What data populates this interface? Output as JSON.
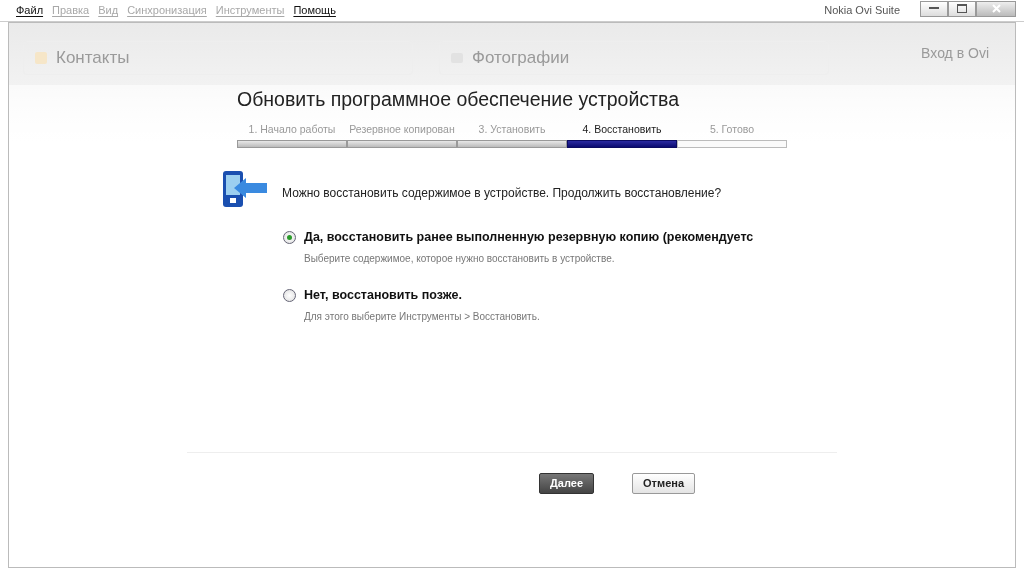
{
  "menu": [
    {
      "label": "Файл",
      "disabled": false
    },
    {
      "label": "Правка",
      "disabled": true
    },
    {
      "label": "Вид",
      "disabled": true
    },
    {
      "label": "Синхронизация",
      "disabled": true
    },
    {
      "label": "Инструменты",
      "disabled": true
    },
    {
      "label": "Помощь",
      "disabled": false
    }
  ],
  "window": {
    "title": "Nokia Ovi Suite"
  },
  "background": {
    "panels": [
      "Контакты",
      "Фотографии"
    ],
    "sign_in": "Вход в Ovi"
  },
  "dialog": {
    "title": "Обновить программное обеспечение устройства",
    "steps": [
      {
        "label": "1. Начало работы",
        "completed": true,
        "selected": false
      },
      {
        "label": "Резервное копирован",
        "completed": true,
        "selected": false
      },
      {
        "label": "3. Установить",
        "completed": true,
        "selected": false
      },
      {
        "label": "4. Восстановить",
        "completed": false,
        "selected": true
      },
      {
        "label": "5. Готово",
        "completed": false,
        "selected": false
      }
    ],
    "question": "Можно восстановить содержимое в устройстве. Продолжить восстановление?",
    "options": [
      {
        "label": "Да, восстановить ранее выполненную резервную копию (рекомендуетс",
        "hint": "Выберите содержимое, которое нужно восстановить в устройстве.",
        "selected": true
      },
      {
        "label": "Нет, восстановить позже.",
        "hint": "Для этого выберите Инструменты > Восстановить.",
        "selected": false
      }
    ],
    "buttons": [
      {
        "label": "Далее",
        "kind": "primary"
      },
      {
        "label": "Отмена",
        "kind": "secondary"
      }
    ]
  }
}
